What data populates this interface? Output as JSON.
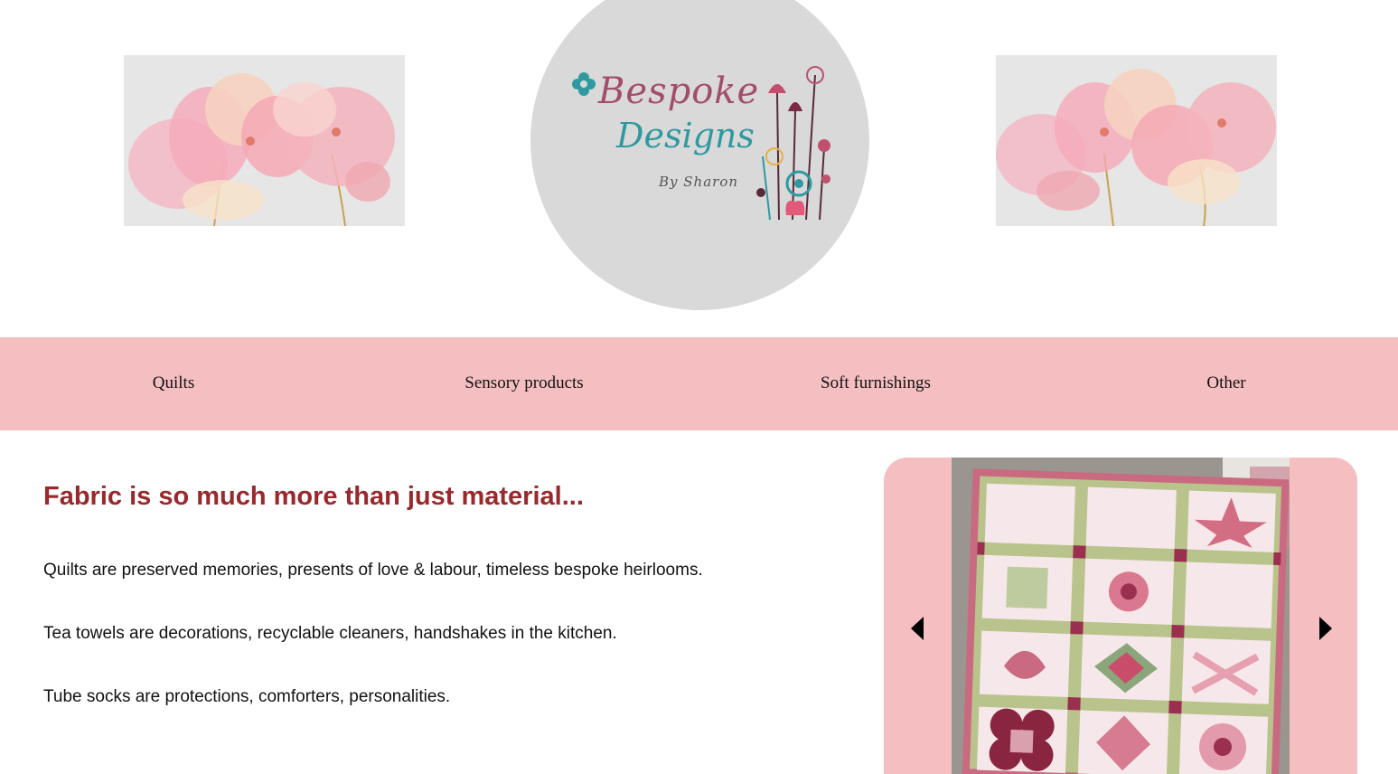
{
  "header": {
    "logo": {
      "title": "Bespoke",
      "subtitle": "Designs",
      "byline": "By Sharon",
      "colors": {
        "title": "#a24d6a",
        "subtitle": "#2e9aa0",
        "circle": "#d9d9d9"
      }
    },
    "decorative_images": [
      "watercolor-flowers-left",
      "watercolor-flowers-right"
    ]
  },
  "nav": {
    "background": "#f5bfc2",
    "items": [
      {
        "label": "Quilts"
      },
      {
        "label": "Sensory products"
      },
      {
        "label": "Soft furnishings"
      },
      {
        "label": "Other"
      }
    ]
  },
  "main": {
    "headline": "Fabric is so much more than just material...",
    "headline_color": "#98292c",
    "paragraphs": [
      "Quilts are preserved memories, presents of love & labour, timeless bespoke heirlooms.",
      "Tea towels are decorations, recyclable cleaners, handshakes in the kitchen.",
      "Tube socks are protections, comforters, personalities."
    ]
  },
  "carousel": {
    "image": "sampler-quilt-photo",
    "prev_icon": "chevron-left-icon",
    "next_icon": "chevron-right-icon"
  }
}
